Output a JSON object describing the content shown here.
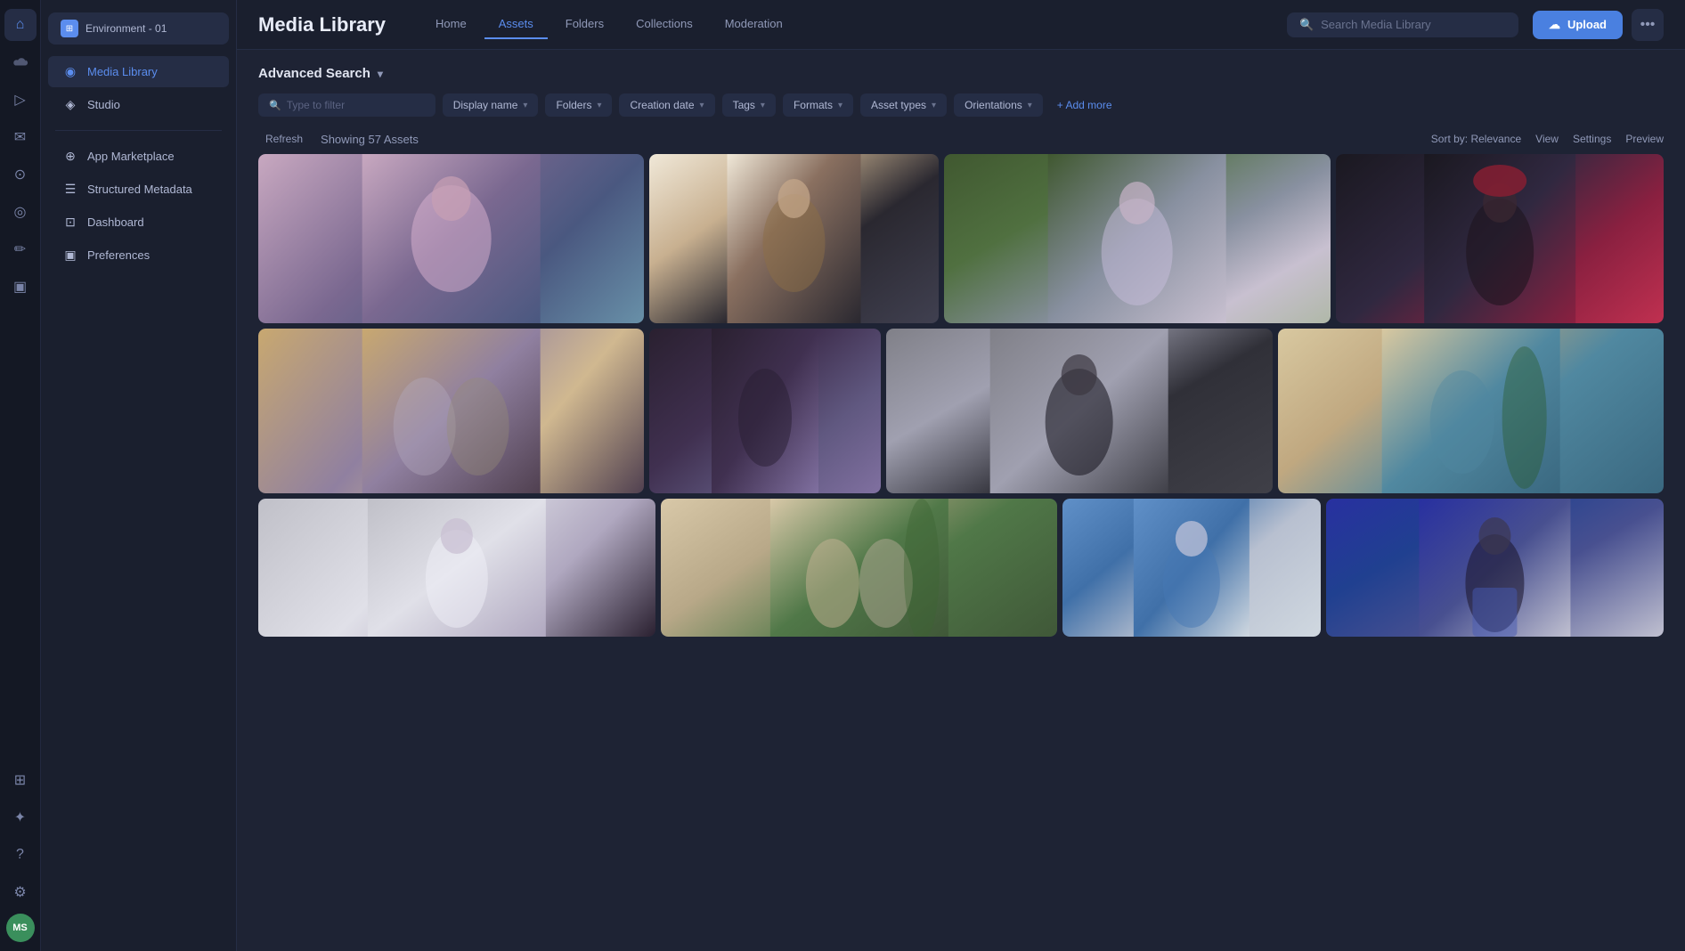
{
  "app": {
    "title": "Media Library"
  },
  "environment": {
    "name": "Environment - 01"
  },
  "icon_sidebar": {
    "icons": [
      {
        "name": "home-icon",
        "glyph": "⌂"
      },
      {
        "name": "cloud-icon",
        "glyph": "☁"
      },
      {
        "name": "media-icon",
        "glyph": "▶"
      },
      {
        "name": "chat-icon",
        "glyph": "💬"
      },
      {
        "name": "person-icon",
        "glyph": "👤"
      },
      {
        "name": "speech-icon",
        "glyph": "💭"
      },
      {
        "name": "edit-icon",
        "glyph": "✏"
      },
      {
        "name": "video-icon",
        "glyph": "🎬"
      }
    ],
    "bottom_icons": [
      {
        "name": "users-icon",
        "glyph": "👥"
      },
      {
        "name": "plugin-icon",
        "glyph": "🔌"
      },
      {
        "name": "help-icon",
        "glyph": "?"
      },
      {
        "name": "settings-icon",
        "glyph": "⚙"
      }
    ],
    "avatar": {
      "initials": "MS"
    }
  },
  "left_nav": {
    "items": [
      {
        "id": "media-library",
        "label": "Media Library",
        "active": true
      },
      {
        "id": "studio",
        "label": "Studio",
        "active": false
      }
    ],
    "bottom_items": [
      {
        "id": "app-marketplace",
        "label": "App Marketplace"
      },
      {
        "id": "structured-metadata",
        "label": "Structured Metadata"
      },
      {
        "id": "dashboard",
        "label": "Dashboard"
      },
      {
        "id": "preferences",
        "label": "Preferences"
      }
    ]
  },
  "topbar": {
    "title": "Media Library",
    "tabs": [
      {
        "id": "home",
        "label": "Home"
      },
      {
        "id": "assets",
        "label": "Assets",
        "active": true
      },
      {
        "id": "folders",
        "label": "Folders"
      },
      {
        "id": "collections",
        "label": "Collections"
      },
      {
        "id": "moderation",
        "label": "Moderation"
      }
    ],
    "search": {
      "placeholder": "Search Media Library"
    },
    "upload_label": "Upload",
    "more_dots": "•••"
  },
  "filters": {
    "advanced_search_label": "Advanced Search",
    "type_to_filter_placeholder": "Type to filter",
    "chips": [
      {
        "id": "display-name",
        "label": "Display name"
      },
      {
        "id": "folders",
        "label": "Folders"
      },
      {
        "id": "creation-date",
        "label": "Creation date"
      },
      {
        "id": "tags",
        "label": "Tags"
      },
      {
        "id": "formats",
        "label": "Formats"
      },
      {
        "id": "asset-types",
        "label": "Asset types"
      },
      {
        "id": "orientations",
        "label": "Orientations"
      }
    ],
    "add_more_label": "+ Add more",
    "refresh_label": "Refresh"
  },
  "results": {
    "count_text": "Showing 57 Assets",
    "sort_label": "Sort by: Relevance",
    "view_label": "View",
    "settings_label": "Settings",
    "preview_label": "Preview"
  },
  "photos": {
    "row1": [
      {
        "id": "photo-1",
        "color_class": "photo-p1",
        "alt": "Woman in pink sweater lying on blue couch"
      },
      {
        "id": "photo-2",
        "color_class": "photo-p2",
        "alt": "Woman in brown coat with tropical leaves"
      },
      {
        "id": "photo-3",
        "color_class": "photo-p3",
        "alt": "Woman in lavender dress on ivy wall"
      },
      {
        "id": "photo-4",
        "color_class": "photo-p4",
        "alt": "Woman in dark outfit with burgundy hat"
      }
    ],
    "row2": [
      {
        "id": "photo-5",
        "color_class": "photo-p5",
        "alt": "Two women at Barcelona arch"
      },
      {
        "id": "photo-6",
        "color_class": "photo-p6",
        "alt": "Woman in black turtleneck on purple couch"
      },
      {
        "id": "photo-7",
        "color_class": "photo-p7",
        "alt": "Woman in black turtleneck against concrete wall"
      },
      {
        "id": "photo-8",
        "color_class": "photo-p8",
        "alt": "Woman in blue blouse with green plant"
      }
    ],
    "row3": [
      {
        "id": "photo-9",
        "color_class": "photo-p9",
        "alt": "Woman in white dress standing"
      },
      {
        "id": "photo-10",
        "color_class": "photo-p10",
        "alt": "Two women near plant in beige room"
      },
      {
        "id": "photo-11",
        "color_class": "photo-p11",
        "alt": "Woman in blue blouse portrait"
      },
      {
        "id": "photo-12",
        "color_class": "photo-p12",
        "alt": "Woman in black top with blue skirt"
      }
    ]
  }
}
